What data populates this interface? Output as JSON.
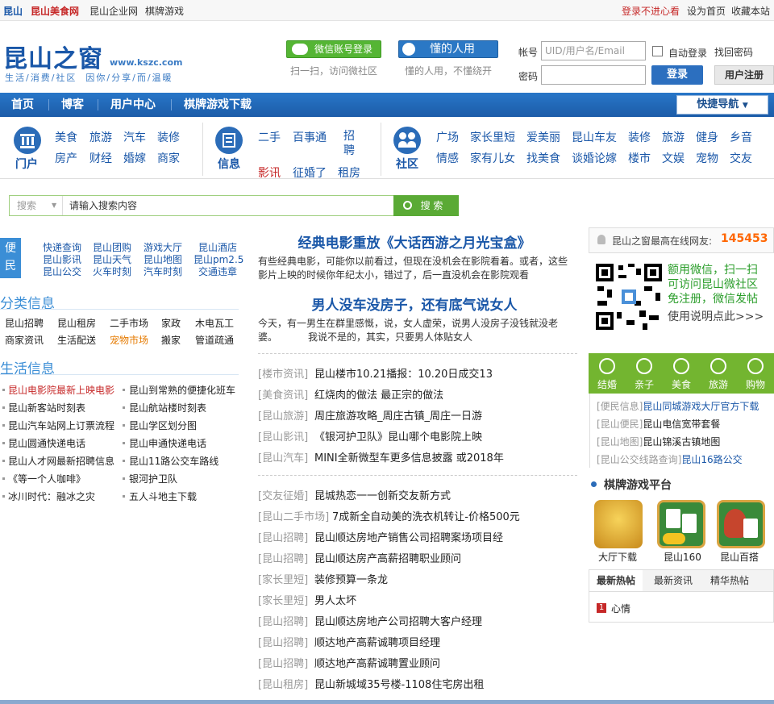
{
  "topbar": {
    "site": "昆山",
    "food": "昆山美食网",
    "biz": "昆山企业网",
    "game": "棋牌游戏",
    "login_warn": "登录不进心看",
    "set_home": "设为首页",
    "favorite": "收藏本站"
  },
  "logo": {
    "name": "昆山之窗",
    "url": "www.kszc.com",
    "slogan_left": "生活/消费/社区",
    "slogan_right": "因你/分享/而/温暖"
  },
  "wechat": {
    "button": "微信账号登录",
    "hint": "扫一扫，访问微社区"
  },
  "dongren": {
    "button": "懂的人用",
    "hint": "懂的人用，不懂绕开"
  },
  "login": {
    "account_label": "帐号",
    "account_placeholder": "UID/用户名/Email",
    "password_label": "密码",
    "auto_login": "自动登录",
    "forgot": "找回密码",
    "login_btn": "登录",
    "register_btn": "用户注册"
  },
  "nav": {
    "items": [
      "首页",
      "博客",
      "用户中心",
      "棋牌游戏下载"
    ],
    "quick": "快捷导航"
  },
  "categories": {
    "portal": {
      "title": "门户",
      "links": [
        "美食",
        "旅游",
        "汽车",
        "装修",
        "房产",
        "财经",
        "婚嫁",
        "商家"
      ]
    },
    "info": {
      "title": "信息",
      "links": [
        "二手",
        "百事通",
        "招聘",
        "影讯",
        "征婚了",
        "租房"
      ]
    },
    "community": {
      "title": "社区",
      "links": [
        "广场",
        "家长里短",
        "爱美丽",
        "昆山车友",
        "装修",
        "旅游",
        "健身",
        "乡音",
        "情感",
        "家有儿女",
        "找美食",
        "谈婚论嫁",
        "楼市",
        "文娱",
        "宠物",
        "交友"
      ]
    }
  },
  "search": {
    "select": "搜索",
    "placeholder": "请输入搜索内容",
    "button": "搜 索"
  },
  "bianmin": {
    "label": "便民",
    "links": [
      "快递查询",
      "昆山团购",
      "游戏大厅",
      "昆山酒店",
      "昆山影讯",
      "昆山天气",
      "昆山地图",
      "昆山pm2.5",
      "昆山公交",
      "火车时刻",
      "汽车时刻",
      "交通违章"
    ]
  },
  "classify": {
    "title": "分类信息",
    "links": [
      "昆山招聘",
      "昆山租房",
      "二手市场",
      "家政",
      "木电瓦工",
      "商家资讯",
      "生活配送",
      "宠物市场",
      "搬家",
      "管道疏通"
    ]
  },
  "life": {
    "title": "生活信息",
    "left": [
      "昆山电影院最新上映电影",
      "昆山新客站时刻表",
      "昆山汽车站网上订票流程",
      "昆山圆通快递电话",
      "昆山人才网最新招聘信息",
      "《等一个人咖啡》",
      "冰川时代：融冰之灾"
    ],
    "right": [
      "昆山到常熟的便捷化班车",
      "昆山航站楼时刻表",
      "昆山学区划分图",
      "昆山申通快递电话",
      "昆山11路公交车路线",
      "银河护卫队",
      "五人斗地主下载"
    ]
  },
  "headline1": {
    "title": "经典电影重放《大话西游之月光宝盒》",
    "text": "有些经典电影，可能你以前看过，但现在没机会在影院看着。或者，这些影片上映的时候你年纪太小，错过了，后一直没机会在影院观看"
  },
  "headline2": {
    "title": "男人没车没房子，还有底气说女人",
    "text1": "今天，有一男生在群里感慨，说，女人虚荣，说男人没房子没钱就没老婆。",
    "text2": "我说不是的，其实，只要男人体贴女人"
  },
  "news1": [
    {
      "tag": "[楼市资讯]",
      "text": "昆山楼市10.21播报：10.20日成交13"
    },
    {
      "tag": "[美食资讯]",
      "text": "红烧肉的做法 最正宗的做法"
    },
    {
      "tag": "[昆山旅游]",
      "text": "周庄旅游攻略_周庄古镇_周庄一日游"
    },
    {
      "tag": "[昆山影讯]",
      "text": "《银河护卫队》昆山哪个电影院上映"
    },
    {
      "tag": "[昆山汽车]",
      "text": "MINI全新微型车更多信息披露 或2018年"
    }
  ],
  "news2": [
    {
      "tag": "[交友征婚]",
      "text": "昆城热恋一一创新交友新方式"
    },
    {
      "tag": "[昆山二手市场]",
      "text": "7成新全自动美的洗衣机转让-价格500元"
    },
    {
      "tag": "[昆山招聘]",
      "text": "昆山顺达房地产销售公司招聘案场项目经"
    },
    {
      "tag": "[昆山招聘]",
      "text": "昆山顺达房产高薪招聘职业顾问"
    },
    {
      "tag": "[家长里短]",
      "text": "装修预算一条龙"
    },
    {
      "tag": "[家长里短]",
      "text": "男人太坏"
    },
    {
      "tag": "[昆山招聘]",
      "text": "昆山顺达房地产公司招聘大客户经理"
    },
    {
      "tag": "[昆山招聘]",
      "text": "顺达地产高薪诚聘项目经理"
    },
    {
      "tag": "[昆山招聘]",
      "text": "顺达地产高薪诚聘置业顾问"
    },
    {
      "tag": "[昆山租房]",
      "text": "昆山新城域35号楼-1108住宅房出租"
    }
  ],
  "online": {
    "label": "昆山之窗最高在线网友:",
    "count": "145453"
  },
  "qr": {
    "line1": "额用微信，扫一扫",
    "line2": "可访问昆山微社区",
    "line3": "免注册，微信发帖",
    "line4": "使用说明点此>>>"
  },
  "tiles": [
    "结婚",
    "亲子",
    "美食",
    "旅游",
    "购物"
  ],
  "rlinks": [
    {
      "tag": "[便民信息]",
      "text": "昆山同城游戏大厅官方下载"
    },
    {
      "tag": "[昆山便民]",
      "text": "昆山电信宽带套餐"
    },
    {
      "tag": "[昆山地图]",
      "text": "昆山锦溪古镇地图"
    },
    {
      "tag": "[昆山公交线路查询]",
      "text": "昆山16路公交"
    }
  ],
  "games": {
    "title": "棋牌游戏平台",
    "items": [
      "大厅下载",
      "昆山160",
      "昆山百搭"
    ]
  },
  "hot": {
    "tabs": [
      "最新热帖",
      "最新资讯",
      "精华热帖"
    ],
    "item_num": "1",
    "item": "心情"
  },
  "colors": {
    "brand_blue": "#1a57a8",
    "nav_blue": "#2876c8",
    "green": "#73b530",
    "red": "#c62828",
    "orange": "#ff6600"
  }
}
